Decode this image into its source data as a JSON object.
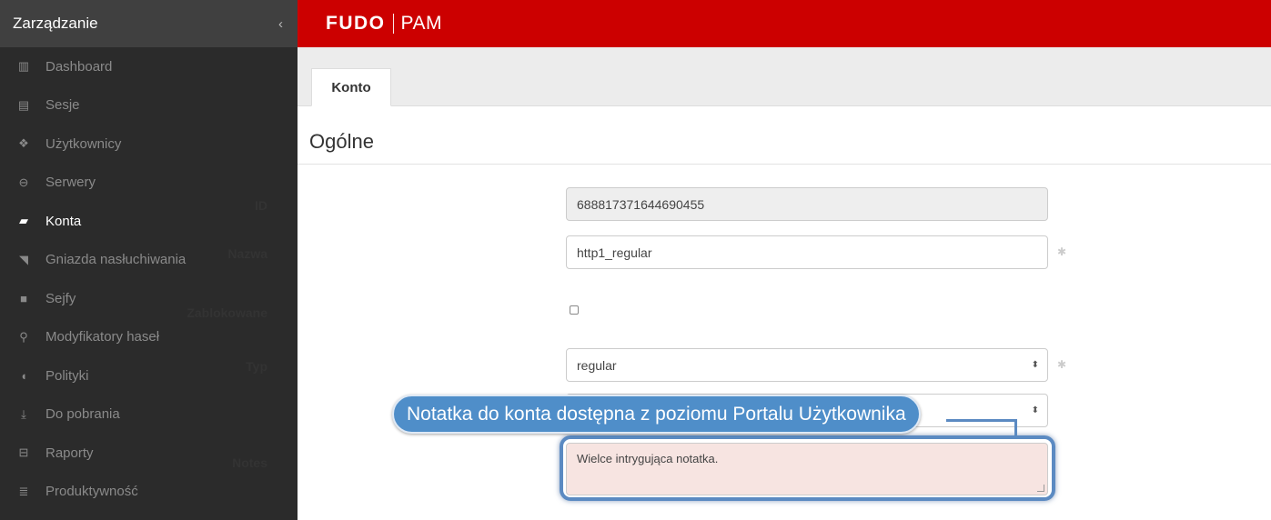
{
  "sidebar": {
    "title": "Zarządzanie",
    "collapse_icon": "‹",
    "items": [
      {
        "label": "Dashboard",
        "icon": "bar-chart-icon",
        "glyph": "▥",
        "active": false
      },
      {
        "label": "Sesje",
        "icon": "film-icon",
        "glyph": "▤",
        "active": false
      },
      {
        "label": "Użytkownicy",
        "icon": "users-icon",
        "glyph": "❖",
        "active": false
      },
      {
        "label": "Serwery",
        "icon": "server-icon",
        "glyph": "⊖",
        "active": false
      },
      {
        "label": "Konta",
        "icon": "book-icon",
        "glyph": "▰",
        "active": true
      },
      {
        "label": "Gniazda nasłuchiwania",
        "icon": "rss-icon",
        "glyph": "◥",
        "active": false
      },
      {
        "label": "Sejfy",
        "icon": "safe-icon",
        "glyph": "■",
        "active": false
      },
      {
        "label": "Modyfikatory haseł",
        "icon": "sitemap-icon",
        "glyph": "⚲",
        "active": false
      },
      {
        "label": "Polityki",
        "icon": "shield-icon",
        "glyph": "◖",
        "active": false
      },
      {
        "label": "Do pobrania",
        "icon": "download-icon",
        "glyph": "⤓",
        "active": false
      },
      {
        "label": "Raporty",
        "icon": "print-icon",
        "glyph": "⊟",
        "active": false
      },
      {
        "label": "Produktywność",
        "icon": "list-icon",
        "glyph": "≣",
        "active": false
      }
    ]
  },
  "topbar": {
    "brand_primary": "FUDO",
    "brand_secondary": "PAM",
    "color": "#cc0000"
  },
  "tabs": [
    {
      "label": "Konto",
      "active": true
    }
  ],
  "section": {
    "title": "Ogólne"
  },
  "form": {
    "id_label": "ID",
    "id_value": "688817371644690455",
    "name_label": "Nazwa",
    "name_value": "http1_regular",
    "locked_label": "Zablokowane",
    "locked_checked": false,
    "type_label": "Typ",
    "type_value": "regular",
    "notes_label": "Notes",
    "notes_value": "Wielce intrygująca notatka.",
    "required_marker": "✱",
    "select_arrows": "⬍"
  },
  "annotation": {
    "callout_text": "Notatka do konta dostępna z poziomu Portalu Użytkownika",
    "color": "#4f8ec9"
  }
}
